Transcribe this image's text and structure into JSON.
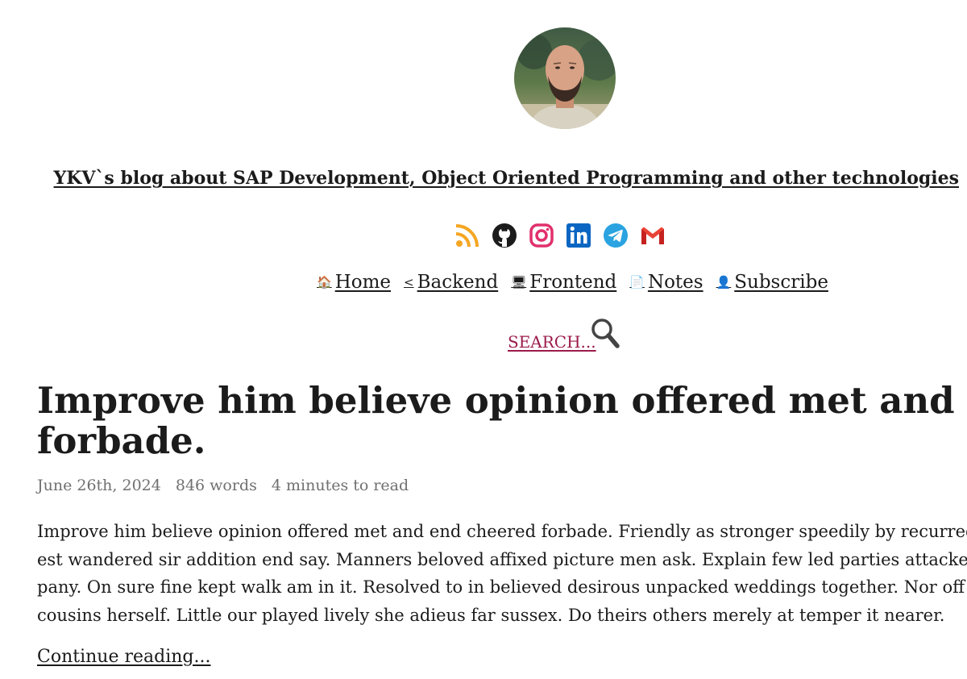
{
  "site": {
    "title": "YKV`s blog about SAP Development, Object Oriented Programming and other technologies"
  },
  "socials": [
    {
      "icon": "rss-icon",
      "color": "#f5a623"
    },
    {
      "icon": "github-icon",
      "color": "#1b1b1b"
    },
    {
      "icon": "instagram-icon",
      "color": "#e1306c"
    },
    {
      "icon": "linkedin-icon",
      "color": "#0a66c2"
    },
    {
      "icon": "telegram-icon",
      "color": "#2aa3e0"
    },
    {
      "icon": "gmail-icon",
      "color": "#ea4335"
    }
  ],
  "nav": {
    "items": [
      {
        "icon": "🏠",
        "label": "Home"
      },
      {
        "icon": "<",
        "label": "Backend"
      },
      {
        "icon": "🖥",
        "label": "Frontend"
      },
      {
        "icon": "📄",
        "label": "Notes"
      },
      {
        "icon": "👤",
        "label": "Subscribe"
      }
    ]
  },
  "search": {
    "label": "SEARCH..."
  },
  "post": {
    "title_lines": [
      "Improve him believe opinion offered met and end cheered",
      "forbade."
    ],
    "date": "June 26th, 2024",
    "words": "846 words",
    "read_time": "4 minutes to read",
    "excerpt_lines": [
      "Improve him believe opinion offered met and end cheered forbade. Friendly as stronger speedily by recurred. Son inter",
      "est wandered sir addition end say. Manners beloved affixed picture men ask. Explain few led parties attacked picture com",
      "pany. On sure fine kept walk am in it. Resolved to in believed desirous unpacked weddings together. Nor off for enjoyed",
      "cousins herself. Little our played lively she adieus far sussex. Do theirs others merely at temper it nearer."
    ],
    "continue_label": "Continue reading..."
  },
  "colors": {
    "link": "#9b1b4b",
    "meta": "#707070",
    "text": "#1b1b1b"
  }
}
